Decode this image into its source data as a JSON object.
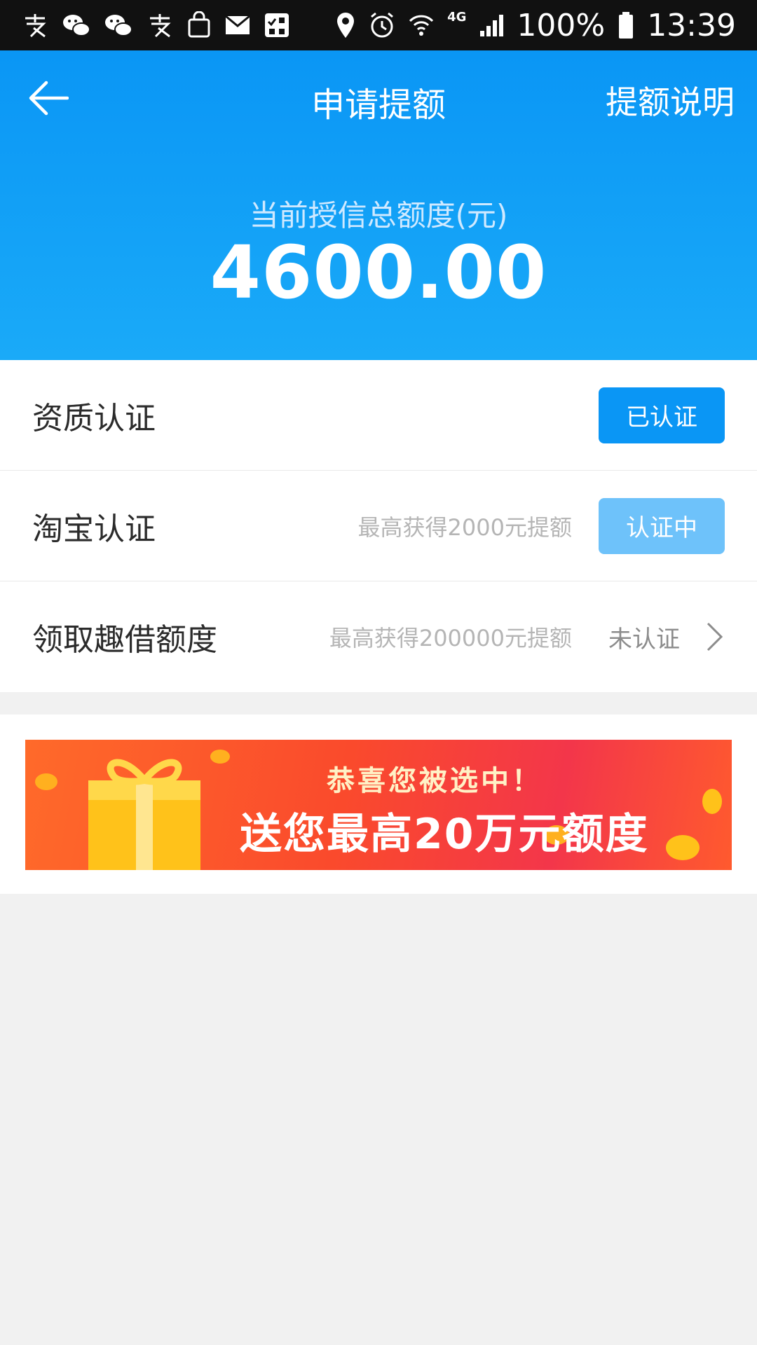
{
  "status_bar": {
    "left_icons": [
      "alipay-icon",
      "wechat-icon",
      "wechat-icon",
      "alipay-icon",
      "shopping-bag-icon",
      "mail-icon",
      "checklist-icon"
    ],
    "right_icons": [
      "location-icon",
      "alarm-icon",
      "wifi-icon",
      "4g-icon",
      "signal-icon",
      "battery-icon"
    ],
    "network": "4G",
    "battery": "100%",
    "time": "13:39"
  },
  "header": {
    "title": "申请提额",
    "help_link": "提额说明",
    "credit_label": "当前授信总额度(元)",
    "credit_amount": "4600.00"
  },
  "list": [
    {
      "title": "资质认证",
      "hint": "",
      "status": "已认证"
    },
    {
      "title": "淘宝认证",
      "hint": "最高获得2000元提额",
      "status": "认证中"
    },
    {
      "title": "领取趣借额度",
      "hint": "最高获得200000元提额",
      "status": "未认证"
    }
  ],
  "banner": {
    "line1": "恭喜您被选中！",
    "line2": "送您最高20万元额度"
  },
  "colors": {
    "primary": "#0a96f5",
    "pending": "#6ec2fa",
    "background": "#f1f1f1",
    "banner_red": "#f3364a"
  }
}
